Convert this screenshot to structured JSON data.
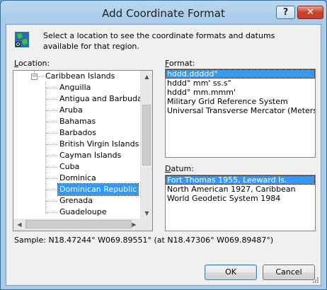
{
  "window": {
    "title": "Add Coordinate Format",
    "help_label": "?",
    "close_label": "✕"
  },
  "intro_text": "Select a location to see the coordinate formats and datums available for that region.",
  "location": {
    "label_underlined": "L",
    "label_rest": "ocation:",
    "tree": {
      "parent": "Caribbean Islands",
      "items": [
        "Anguilla",
        "Antigua and Barbuda",
        "Aruba",
        "Bahamas",
        "Barbados",
        "British Virgin Islands",
        "Cayman Islands",
        "Cuba",
        "Dominica",
        "Dominican Republic",
        "Grenada",
        "Guadeloupe"
      ],
      "selected": "Dominican Republic"
    }
  },
  "format": {
    "label_underlined": "F",
    "label_rest": "ormat:",
    "items": [
      "hddd.ddddd°",
      "hddd° mm' ss.s\"",
      "hddd° mm.mmm'",
      "Military Grid Reference System",
      "Universal Transverse Mercator (Meters)"
    ],
    "selected": "hddd.ddddd°"
  },
  "datum": {
    "label_underlined": "D",
    "label_rest": "atum:",
    "items": [
      "Fort Thomas 1955, Leeward Is.",
      "North American 1927, Caribbean",
      "World Geodetic System 1984"
    ],
    "selected": "Fort Thomas 1955, Leeward Is."
  },
  "sample_text": "Sample: N18.47244°  W069.89551° (at N18.47306°  W069.89487°)",
  "buttons": {
    "ok": "OK",
    "cancel": "Cancel"
  },
  "colors": {
    "selection": "#3399ff",
    "title_bar": "#a8cbea",
    "close_button": "#c5412c"
  }
}
